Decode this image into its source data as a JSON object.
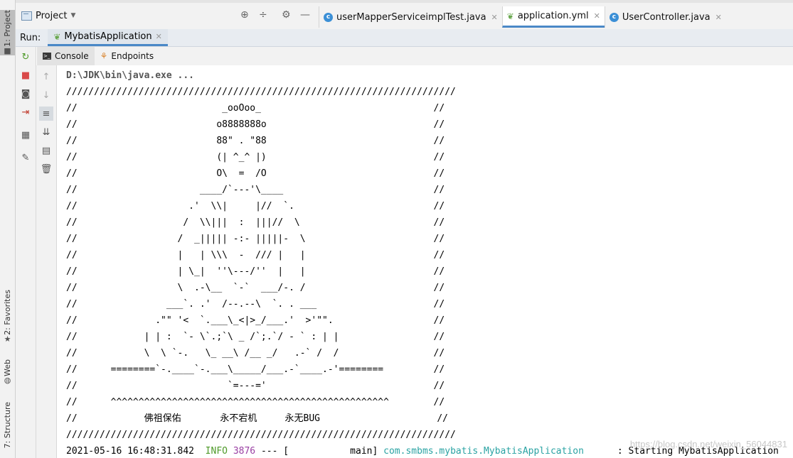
{
  "left_stripe": {
    "project_tab": "1: Project",
    "favorites_tab": "2: Favorites",
    "web_tab": "Web",
    "structure_tab": "7: Structure"
  },
  "topbar": {
    "project_label": "Project",
    "tabs": [
      {
        "label": "userMapperServiceimplTest.java",
        "icon": "class-c-icon"
      },
      {
        "label": "application.yml",
        "icon": "spring-leaf-icon"
      },
      {
        "label": "UserController.java",
        "icon": "class-c-icon"
      }
    ]
  },
  "run": {
    "label": "Run:",
    "config_name": "MybatisApplication"
  },
  "inner_tabs": {
    "console": "Console",
    "endpoints": "Endpoints"
  },
  "console": {
    "command": "D:\\JDK\\bin\\java.exe ...",
    "banner": [
      "//////////////////////////////////////////////////////////////////////",
      "//                          _ooOoo_                               //",
      "//                         o8888888o                              //",
      "//                         88\" . \"88                              //",
      "//                         (| ^_^ |)                              //",
      "//                         O\\  =  /O                              //",
      "//                      ____/`---'\\____                           //",
      "//                    .'  \\\\|     |//  `.                         //",
      "//                   /  \\\\|||  :  |||//  \\                        //",
      "//                  /  _||||| -:- |||||-  \\                       //",
      "//                  |   | \\\\\\  -  /// |   |                       //",
      "//                  | \\_|  ''\\---/''  |   |                       //",
      "//                  \\  .-\\__  `-`  ___/-. /                       //",
      "//                ___`. .'  /--.--\\  `. . ___                     //",
      "//              .\"\" '<  `.___\\_<|>_/___.'  >'\"\".                  //",
      "//            | | :  `- \\`.;`\\ _ /`;.`/ - ` : | |                 //",
      "//            \\  \\ `-.   \\_ __\\ /__ _/   .-` /  /                 //",
      "//      ========`-.____`-.___\\_____/___.-`____.-'========         //",
      "//                           `=---='                              //",
      "//      ^^^^^^^^^^^^^^^^^^^^^^^^^^^^^^^^^^^^^^^^^^^^^^^^^^        //",
      "//            佛祖保佑       永不宕机     永无BUG                     //",
      "//////////////////////////////////////////////////////////////////////"
    ],
    "log": {
      "timestamp": "2021-05-16 16:48:31.842",
      "level": "INFO",
      "pid": "3876",
      "sep": "---",
      "thread": "[           main]",
      "logger": "com.smbms.mybatis.MybatisApplication",
      "message": ": Starting MybatisApplication"
    }
  },
  "watermark": "https://blog.csdn.net/weixin_56044831"
}
